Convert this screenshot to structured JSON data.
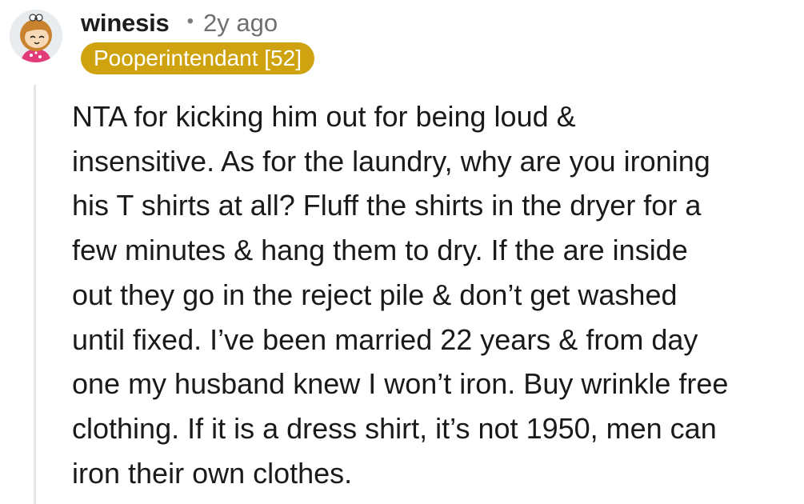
{
  "comment": {
    "username": "winesis",
    "separator": "•",
    "timestamp": "2y ago",
    "flair": "Pooperintendant [52]",
    "avatar_icon": "snoo-avatar-icon",
    "colors": {
      "flair_bg": "#cfa30f",
      "flair_text": "#ffffff",
      "thread_line": "#e4e6e8",
      "text": "#1a1a1b",
      "meta": "#6f6f6f"
    },
    "body_lines": [
      "NTA for kicking him out for being loud &",
      "insensitive. As for the laundry, why are you ironing",
      "his T shirts at all? Fluff the shirts in the dryer for a",
      "few minutes & hang them to dry. If the are inside",
      "out they go in the reject pile & don’t get washed",
      "until fixed. I’ve been married 22 years & from day",
      "one my husband knew I won’t iron. Buy wrinkle free",
      "clothing. If it is a dress shirt, it’s not 1950, men can",
      "iron their own clothes."
    ]
  }
}
